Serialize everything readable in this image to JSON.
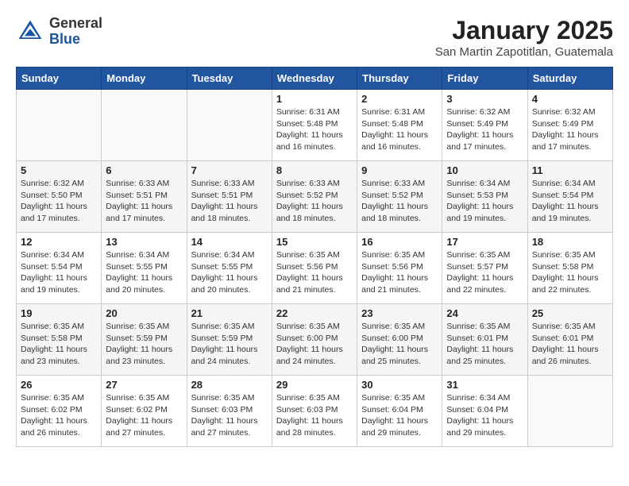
{
  "header": {
    "logo_general": "General",
    "logo_blue": "Blue",
    "title": "January 2025",
    "subtitle": "San Martin Zapotitlan, Guatemala"
  },
  "days_of_week": [
    "Sunday",
    "Monday",
    "Tuesday",
    "Wednesday",
    "Thursday",
    "Friday",
    "Saturday"
  ],
  "weeks": [
    [
      {
        "day": "",
        "info": ""
      },
      {
        "day": "",
        "info": ""
      },
      {
        "day": "",
        "info": ""
      },
      {
        "day": "1",
        "info": "Sunrise: 6:31 AM\nSunset: 5:48 PM\nDaylight: 11 hours and 16 minutes."
      },
      {
        "day": "2",
        "info": "Sunrise: 6:31 AM\nSunset: 5:48 PM\nDaylight: 11 hours and 16 minutes."
      },
      {
        "day": "3",
        "info": "Sunrise: 6:32 AM\nSunset: 5:49 PM\nDaylight: 11 hours and 17 minutes."
      },
      {
        "day": "4",
        "info": "Sunrise: 6:32 AM\nSunset: 5:49 PM\nDaylight: 11 hours and 17 minutes."
      }
    ],
    [
      {
        "day": "5",
        "info": "Sunrise: 6:32 AM\nSunset: 5:50 PM\nDaylight: 11 hours and 17 minutes."
      },
      {
        "day": "6",
        "info": "Sunrise: 6:33 AM\nSunset: 5:51 PM\nDaylight: 11 hours and 17 minutes."
      },
      {
        "day": "7",
        "info": "Sunrise: 6:33 AM\nSunset: 5:51 PM\nDaylight: 11 hours and 18 minutes."
      },
      {
        "day": "8",
        "info": "Sunrise: 6:33 AM\nSunset: 5:52 PM\nDaylight: 11 hours and 18 minutes."
      },
      {
        "day": "9",
        "info": "Sunrise: 6:33 AM\nSunset: 5:52 PM\nDaylight: 11 hours and 18 minutes."
      },
      {
        "day": "10",
        "info": "Sunrise: 6:34 AM\nSunset: 5:53 PM\nDaylight: 11 hours and 19 minutes."
      },
      {
        "day": "11",
        "info": "Sunrise: 6:34 AM\nSunset: 5:54 PM\nDaylight: 11 hours and 19 minutes."
      }
    ],
    [
      {
        "day": "12",
        "info": "Sunrise: 6:34 AM\nSunset: 5:54 PM\nDaylight: 11 hours and 19 minutes."
      },
      {
        "day": "13",
        "info": "Sunrise: 6:34 AM\nSunset: 5:55 PM\nDaylight: 11 hours and 20 minutes."
      },
      {
        "day": "14",
        "info": "Sunrise: 6:34 AM\nSunset: 5:55 PM\nDaylight: 11 hours and 20 minutes."
      },
      {
        "day": "15",
        "info": "Sunrise: 6:35 AM\nSunset: 5:56 PM\nDaylight: 11 hours and 21 minutes."
      },
      {
        "day": "16",
        "info": "Sunrise: 6:35 AM\nSunset: 5:56 PM\nDaylight: 11 hours and 21 minutes."
      },
      {
        "day": "17",
        "info": "Sunrise: 6:35 AM\nSunset: 5:57 PM\nDaylight: 11 hours and 22 minutes."
      },
      {
        "day": "18",
        "info": "Sunrise: 6:35 AM\nSunset: 5:58 PM\nDaylight: 11 hours and 22 minutes."
      }
    ],
    [
      {
        "day": "19",
        "info": "Sunrise: 6:35 AM\nSunset: 5:58 PM\nDaylight: 11 hours and 23 minutes."
      },
      {
        "day": "20",
        "info": "Sunrise: 6:35 AM\nSunset: 5:59 PM\nDaylight: 11 hours and 23 minutes."
      },
      {
        "day": "21",
        "info": "Sunrise: 6:35 AM\nSunset: 5:59 PM\nDaylight: 11 hours and 24 minutes."
      },
      {
        "day": "22",
        "info": "Sunrise: 6:35 AM\nSunset: 6:00 PM\nDaylight: 11 hours and 24 minutes."
      },
      {
        "day": "23",
        "info": "Sunrise: 6:35 AM\nSunset: 6:00 PM\nDaylight: 11 hours and 25 minutes."
      },
      {
        "day": "24",
        "info": "Sunrise: 6:35 AM\nSunset: 6:01 PM\nDaylight: 11 hours and 25 minutes."
      },
      {
        "day": "25",
        "info": "Sunrise: 6:35 AM\nSunset: 6:01 PM\nDaylight: 11 hours and 26 minutes."
      }
    ],
    [
      {
        "day": "26",
        "info": "Sunrise: 6:35 AM\nSunset: 6:02 PM\nDaylight: 11 hours and 26 minutes."
      },
      {
        "day": "27",
        "info": "Sunrise: 6:35 AM\nSunset: 6:02 PM\nDaylight: 11 hours and 27 minutes."
      },
      {
        "day": "28",
        "info": "Sunrise: 6:35 AM\nSunset: 6:03 PM\nDaylight: 11 hours and 27 minutes."
      },
      {
        "day": "29",
        "info": "Sunrise: 6:35 AM\nSunset: 6:03 PM\nDaylight: 11 hours and 28 minutes."
      },
      {
        "day": "30",
        "info": "Sunrise: 6:35 AM\nSunset: 6:04 PM\nDaylight: 11 hours and 29 minutes."
      },
      {
        "day": "31",
        "info": "Sunrise: 6:34 AM\nSunset: 6:04 PM\nDaylight: 11 hours and 29 minutes."
      },
      {
        "day": "",
        "info": ""
      }
    ]
  ]
}
